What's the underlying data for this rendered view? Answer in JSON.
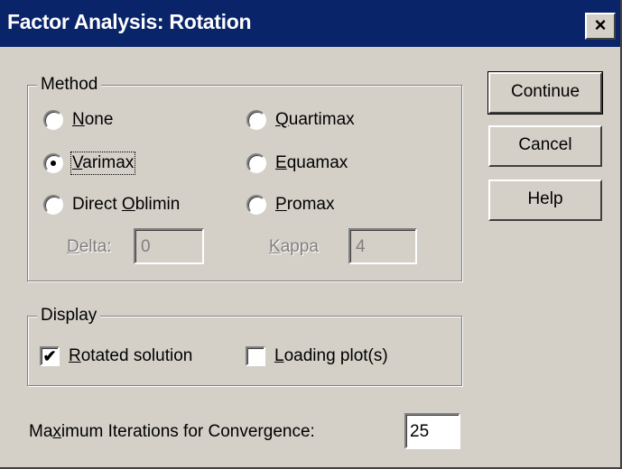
{
  "window": {
    "title": "Factor Analysis: Rotation",
    "close_glyph": "×",
    "close_icon": "close-icon"
  },
  "method": {
    "legend": "Method",
    "options": {
      "none": {
        "pre": "",
        "key": "N",
        "post": "one",
        "checked": false
      },
      "varimax": {
        "pre": "",
        "key": "V",
        "post": "arimax",
        "checked": true
      },
      "direct_oblimin": {
        "pre": "Direct ",
        "key": "O",
        "post": "blimin",
        "checked": false
      },
      "quartimax": {
        "pre": "",
        "key": "Q",
        "post": "uartimax",
        "checked": false
      },
      "equamax": {
        "pre": "",
        "key": "E",
        "post": "quamax",
        "checked": false
      },
      "promax": {
        "pre": "",
        "key": "P",
        "post": "romax",
        "checked": false
      }
    },
    "delta": {
      "pre": "",
      "key": "D",
      "post": "elta:",
      "value": "0",
      "enabled": false
    },
    "kappa": {
      "pre": "",
      "key": "K",
      "post": "appa",
      "value": "4",
      "enabled": false
    }
  },
  "display": {
    "legend": "Display",
    "rotated_solution": {
      "pre": "",
      "key": "R",
      "post": "otated solution",
      "checked": true,
      "check_glyph": "✔"
    },
    "loading_plots": {
      "pre": "",
      "key": "L",
      "post": "oading plot(s)",
      "checked": false
    }
  },
  "max_iterations": {
    "pre": "Ma",
    "key": "x",
    "post": "imum Iterations for Convergence:",
    "value": "25"
  },
  "buttons": {
    "continue": "Continue",
    "cancel": "Cancel",
    "help": "Help"
  },
  "colors": {
    "titlebar": "#0a246a",
    "face": "#d4d0c8",
    "disabled_text": "#808080"
  }
}
